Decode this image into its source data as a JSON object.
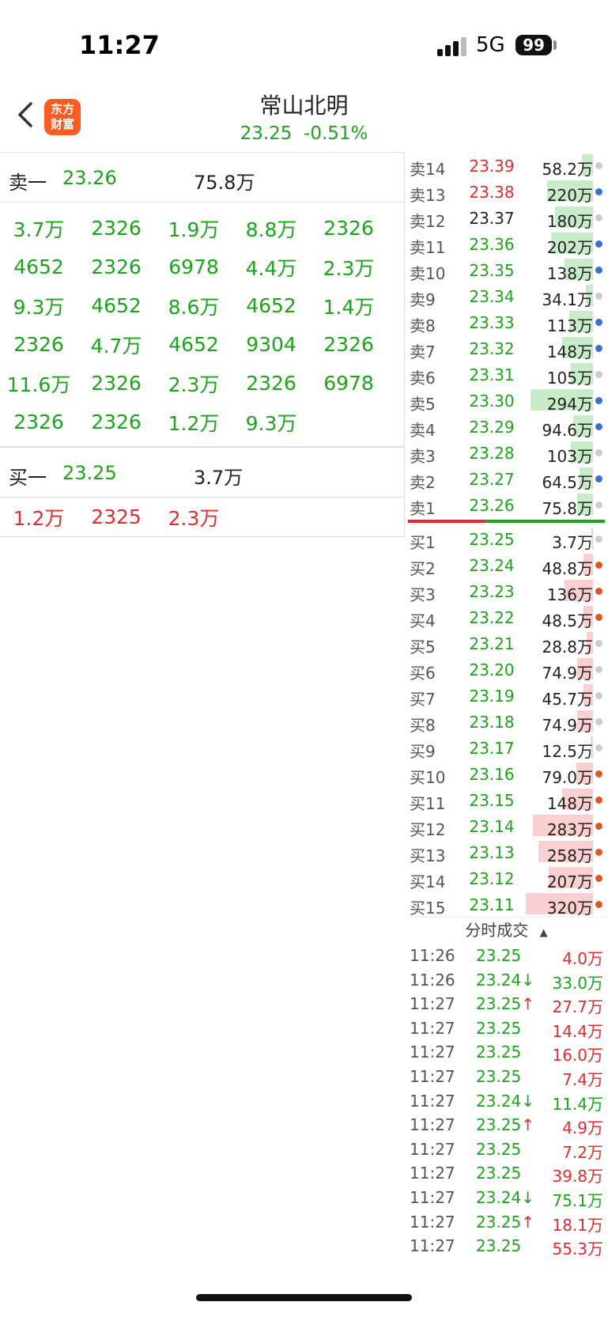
{
  "status": {
    "time": "11:27",
    "network": "5G",
    "battery": "99"
  },
  "header": {
    "name": "常山北明",
    "price": "23.25",
    "change": "-0.51%",
    "logo_line1": "东方",
    "logo_line2": "财富"
  },
  "sell1": {
    "label": "卖一",
    "price": "23.26",
    "volume": "75.8万"
  },
  "sell_queue": [
    [
      "3.7万",
      "2326",
      "1.9万",
      "8.8万",
      "2326"
    ],
    [
      "4652",
      "2326",
      "6978",
      "4.4万",
      "2.3万"
    ],
    [
      "9.3万",
      "4652",
      "8.6万",
      "4652",
      "1.4万"
    ],
    [
      "2326",
      "4.7万",
      "4652",
      "9304",
      "2326"
    ],
    [
      "11.6万",
      "2326",
      "2.3万",
      "2326",
      "6978"
    ],
    [
      "2326",
      "2326",
      "1.2万",
      "9.3万",
      ""
    ]
  ],
  "buy1": {
    "label": "买一",
    "price": "23.25",
    "volume": "3.7万"
  },
  "buy_queue": [
    "1.2万",
    "2325",
    "2.3万"
  ],
  "asks": [
    {
      "label": "卖14",
      "price": "23.39",
      "vol": "58.2万",
      "bar": 0.15,
      "pc": "#e8292e",
      "dot": "#ccc"
    },
    {
      "label": "卖13",
      "price": "23.38",
      "vol": "220万",
      "bar": 0.6,
      "pc": "#e8292e",
      "dot": "#3a6fd8"
    },
    {
      "label": "卖12",
      "price": "23.37",
      "vol": "180万",
      "bar": 0.5,
      "pc": "#222",
      "dot": "#ccc"
    },
    {
      "label": "卖11",
      "price": "23.36",
      "vol": "202万",
      "bar": 0.55,
      "pc": "#1aa51a",
      "dot": "#3a6fd8"
    },
    {
      "label": "卖10",
      "price": "23.35",
      "vol": "138万",
      "bar": 0.38,
      "pc": "#1aa51a",
      "dot": "#3a6fd8"
    },
    {
      "label": "卖9",
      "price": "23.34",
      "vol": "34.1万",
      "bar": 0.09,
      "pc": "#1aa51a",
      "dot": "#ccc"
    },
    {
      "label": "卖8",
      "price": "23.33",
      "vol": "113万",
      "bar": 0.31,
      "pc": "#1aa51a",
      "dot": "#3a6fd8"
    },
    {
      "label": "卖7",
      "price": "23.32",
      "vol": "148万",
      "bar": 0.41,
      "pc": "#1aa51a",
      "dot": "#3a6fd8"
    },
    {
      "label": "卖6",
      "price": "23.31",
      "vol": "105万",
      "bar": 0.29,
      "pc": "#1aa51a",
      "dot": "#ccc"
    },
    {
      "label": "卖5",
      "price": "23.30",
      "vol": "294万",
      "bar": 0.82,
      "pc": "#1aa51a",
      "dot": "#3a6fd8"
    },
    {
      "label": "卖4",
      "price": "23.29",
      "vol": "94.6万",
      "bar": 0.26,
      "pc": "#1aa51a",
      "dot": "#3a6fd8"
    },
    {
      "label": "卖3",
      "price": "23.28",
      "vol": "103万",
      "bar": 0.29,
      "pc": "#1aa51a",
      "dot": "#ccc"
    },
    {
      "label": "卖2",
      "price": "23.27",
      "vol": "64.5万",
      "bar": 0.18,
      "pc": "#1aa51a",
      "dot": "#3a6fd8"
    },
    {
      "label": "卖1",
      "price": "23.26",
      "vol": "75.8万",
      "bar": 0.21,
      "pc": "#1aa51a",
      "dot": "#ccc"
    }
  ],
  "bids": [
    {
      "label": "买1",
      "price": "23.25",
      "vol": "3.7万",
      "bar": 0.01,
      "dot": "#ccc"
    },
    {
      "label": "买2",
      "price": "23.24",
      "vol": "48.8万",
      "bar": 0.13,
      "dot": "#e8541e"
    },
    {
      "label": "买3",
      "price": "23.23",
      "vol": "136万",
      "bar": 0.38,
      "dot": "#e8541e"
    },
    {
      "label": "买4",
      "price": "23.22",
      "vol": "48.5万",
      "bar": 0.13,
      "dot": "#e8541e"
    },
    {
      "label": "买5",
      "price": "23.21",
      "vol": "28.8万",
      "bar": 0.08,
      "dot": "#ccc"
    },
    {
      "label": "买6",
      "price": "23.20",
      "vol": "74.9万",
      "bar": 0.21,
      "dot": "#ccc"
    },
    {
      "label": "买7",
      "price": "23.19",
      "vol": "45.7万",
      "bar": 0.13,
      "dot": "#ccc"
    },
    {
      "label": "买8",
      "price": "23.18",
      "vol": "74.9万",
      "bar": 0.21,
      "dot": "#ccc"
    },
    {
      "label": "买9",
      "price": "23.17",
      "vol": "12.5万",
      "bar": 0.03,
      "dot": "#ccc"
    },
    {
      "label": "买10",
      "price": "23.16",
      "vol": "79.0万",
      "bar": 0.22,
      "dot": "#e8541e"
    },
    {
      "label": "买11",
      "price": "23.15",
      "vol": "148万",
      "bar": 0.41,
      "dot": "#e8541e"
    },
    {
      "label": "买12",
      "price": "23.14",
      "vol": "283万",
      "bar": 0.79,
      "dot": "#e8541e"
    },
    {
      "label": "买13",
      "price": "23.13",
      "vol": "258万",
      "bar": 0.72,
      "dot": "#e8541e"
    },
    {
      "label": "买14",
      "price": "23.12",
      "vol": "207万",
      "bar": 0.58,
      "dot": "#e8541e"
    },
    {
      "label": "买15",
      "price": "23.11",
      "vol": "320万",
      "bar": 0.89,
      "dot": "#e8541e"
    }
  ],
  "trades_title": "分时成交",
  "trades": [
    {
      "time": "11:26",
      "price": "23.25",
      "dir": "",
      "vol": "4.0万",
      "vc": "red"
    },
    {
      "time": "11:26",
      "price": "23.24",
      "dir": "↓",
      "vol": "33.0万",
      "vc": "green"
    },
    {
      "time": "11:27",
      "price": "23.25",
      "dir": "↑",
      "vol": "27.7万",
      "vc": "red"
    },
    {
      "time": "11:27",
      "price": "23.25",
      "dir": "",
      "vol": "14.4万",
      "vc": "red"
    },
    {
      "time": "11:27",
      "price": "23.25",
      "dir": "",
      "vol": "16.0万",
      "vc": "red"
    },
    {
      "time": "11:27",
      "price": "23.25",
      "dir": "",
      "vol": "7.4万",
      "vc": "red"
    },
    {
      "time": "11:27",
      "price": "23.24",
      "dir": "↓",
      "vol": "11.4万",
      "vc": "green"
    },
    {
      "time": "11:27",
      "price": "23.25",
      "dir": "↑",
      "vol": "4.9万",
      "vc": "red"
    },
    {
      "time": "11:27",
      "price": "23.25",
      "dir": "",
      "vol": "7.2万",
      "vc": "red"
    },
    {
      "time": "11:27",
      "price": "23.25",
      "dir": "",
      "vol": "39.8万",
      "vc": "red"
    },
    {
      "time": "11:27",
      "price": "23.24",
      "dir": "↓",
      "vol": "75.1万",
      "vc": "green"
    },
    {
      "time": "11:27",
      "price": "23.25",
      "dir": "↑",
      "vol": "18.1万",
      "vc": "red"
    },
    {
      "time": "11:27",
      "price": "23.25",
      "dir": "",
      "vol": "55.3万",
      "vc": "red"
    }
  ]
}
